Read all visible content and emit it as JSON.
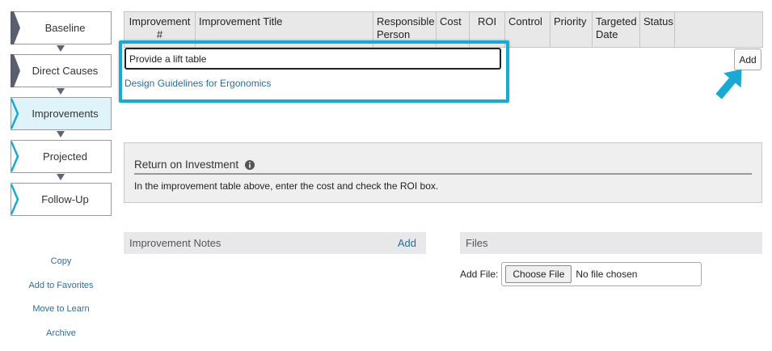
{
  "steps": [
    {
      "label": "Baseline",
      "chevron_color": "#5a5f70"
    },
    {
      "label": "Direct Causes",
      "chevron_color": "#5a5f70"
    },
    {
      "label": "Improvements",
      "chevron_color": "#1aa9d2"
    },
    {
      "label": "Projected",
      "chevron_color": "#1aa9d2"
    },
    {
      "label": "Follow-Up",
      "chevron_color": "#1aa9d2"
    }
  ],
  "side_links": [
    "Copy",
    "Add to Favorites",
    "Move to Learn",
    "Archive"
  ],
  "table": {
    "columns": [
      "Improvement #",
      "Improvement Title",
      "Responsible Person",
      "Cost",
      "ROI",
      "Control",
      "Priority",
      "Targeted Date",
      "Status",
      ""
    ]
  },
  "new_row": {
    "title_value": "Provide a lift table",
    "suggestion": "Design Guidelines for Ergonomics",
    "add_label": "Add"
  },
  "roi": {
    "heading": "Return on Investment",
    "text": "In the improvement table above, enter the cost and check the ROI box."
  },
  "notes": {
    "title": "Improvement Notes",
    "add_label": "Add"
  },
  "files": {
    "title": "Files",
    "add_file_label": "Add File:",
    "choose_label": "Choose File",
    "status": "No file chosen"
  },
  "colors": {
    "accent": "#1aa9d2",
    "link": "#2a6e9c",
    "header_bg": "#e8e8e8"
  }
}
